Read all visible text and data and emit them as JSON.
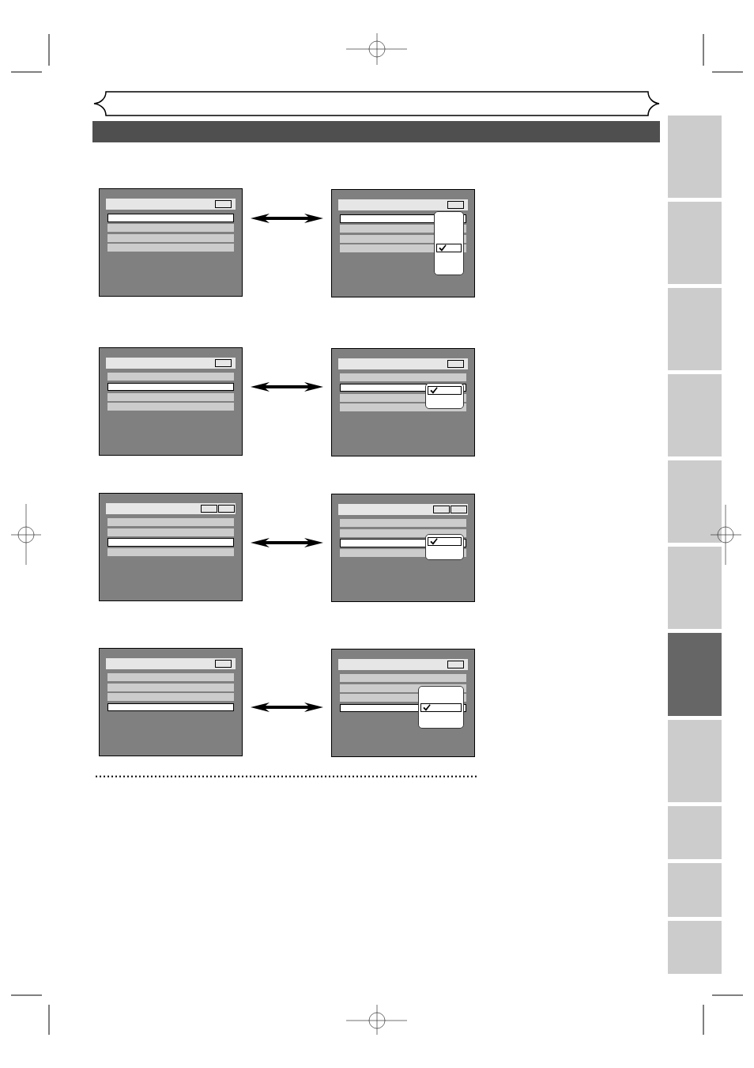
{
  "examples": [
    {
      "menu": {
        "header": {
          "kind": "single"
        },
        "rows": [
          {
            "selected": true
          },
          {
            "selected": false
          },
          {
            "selected": false
          },
          {
            "selected": false
          }
        ]
      },
      "menu_with_popup": {
        "header": {
          "kind": "single"
        },
        "rows": [
          {
            "selected": true
          },
          {
            "selected": false
          },
          {
            "selected": false
          },
          {
            "selected": false
          }
        ],
        "popup": {
          "options": [
            {
              "selected": false
            },
            {
              "selected": false
            },
            {
              "selected": false
            },
            {
              "selected": true
            },
            {
              "selected": false
            },
            {
              "selected": false
            }
          ]
        }
      }
    },
    {
      "menu": {
        "header": {
          "kind": "single"
        },
        "rows": [
          {
            "selected": false
          },
          {
            "selected": true
          },
          {
            "selected": false
          },
          {
            "selected": false
          }
        ]
      },
      "menu_with_popup": {
        "header": {
          "kind": "single"
        },
        "rows": [
          {
            "selected": false
          },
          {
            "selected": true
          },
          {
            "selected": false
          },
          {
            "selected": false
          }
        ],
        "popup": {
          "options": [
            {
              "selected": true
            },
            {
              "selected": false
            }
          ]
        }
      }
    },
    {
      "menu": {
        "header": {
          "kind": "double"
        },
        "rows": [
          {
            "selected": false
          },
          {
            "selected": false
          },
          {
            "selected": true
          },
          {
            "selected": false
          }
        ]
      },
      "menu_with_popup": {
        "header": {
          "kind": "double"
        },
        "rows": [
          {
            "selected": false
          },
          {
            "selected": false
          },
          {
            "selected": true
          },
          {
            "selected": false
          }
        ],
        "popup": {
          "options": [
            {
              "selected": true
            },
            {
              "selected": false
            }
          ]
        }
      }
    },
    {
      "menu": {
        "header": {
          "kind": "single"
        },
        "rows": [
          {
            "selected": false
          },
          {
            "selected": false
          },
          {
            "selected": false
          },
          {
            "selected": true
          }
        ]
      },
      "menu_with_popup": {
        "header": {
          "kind": "single"
        },
        "rows": [
          {
            "selected": false
          },
          {
            "selected": false
          },
          {
            "selected": false
          },
          {
            "selected": true
          }
        ],
        "popup": {
          "options": [
            {
              "selected": false
            },
            {
              "selected": false
            },
            {
              "selected": true
            },
            {
              "selected": false
            },
            {
              "selected": false
            }
          ]
        }
      }
    }
  ],
  "section_tabs": [
    {
      "selected": false
    },
    {
      "selected": false
    },
    {
      "selected": false
    },
    {
      "selected": false
    },
    {
      "selected": false
    },
    {
      "selected": false
    },
    {
      "selected": true
    },
    {
      "selected": false
    },
    {
      "selected": false
    },
    {
      "selected": false
    },
    {
      "selected": false
    }
  ]
}
